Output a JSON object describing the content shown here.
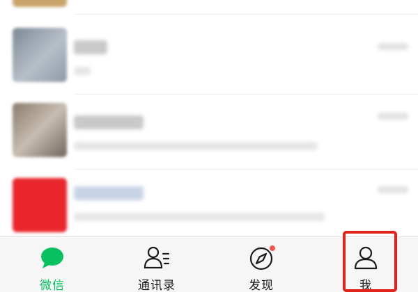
{
  "chat_list": {
    "rows": [
      {
        "avatar_color": "#c9a46a",
        "partial": true
      },
      {
        "avatar_color": "#8e9aa8"
      },
      {
        "avatar_color": "#9b8b7a"
      },
      {
        "avatar_color": "#e8262c"
      }
    ]
  },
  "tabbar": {
    "tabs": [
      {
        "label": "微信",
        "icon": "chat-bubble-icon",
        "active": true
      },
      {
        "label": "通讯录",
        "icon": "contacts-icon",
        "active": false
      },
      {
        "label": "发现",
        "icon": "compass-icon",
        "active": false,
        "badge": true
      },
      {
        "label": "我",
        "icon": "person-icon",
        "active": false,
        "highlighted": true
      }
    ]
  },
  "colors": {
    "accent": "#07c160",
    "badge": "#fa5151",
    "highlight": "#e0241b"
  }
}
